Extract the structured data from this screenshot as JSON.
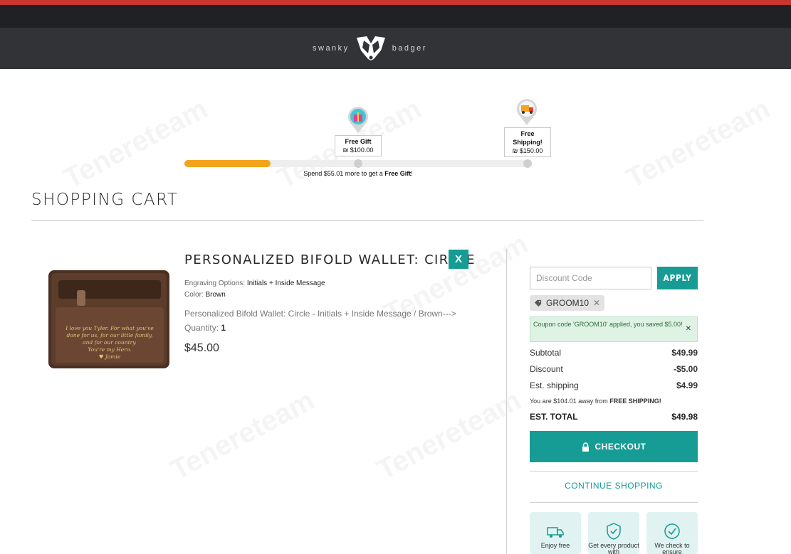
{
  "brand": {
    "left": "swanky",
    "right": "badger"
  },
  "progress": {
    "fill_fraction": 0.25,
    "milestones": [
      {
        "title": "Free Gift",
        "price": "₪ $100.00",
        "icon": "gift-icon"
      },
      {
        "title": "Free Shipping!",
        "price": "₪ $150.00",
        "icon": "truck-icon"
      }
    ],
    "spend_prefix": "Spend $55.01 more to get a ",
    "spend_bold": "Free Gift",
    "spend_suffix": "!"
  },
  "cart": {
    "title": "SHOPPING CART",
    "item": {
      "name": "PERSONALIZED BIFOLD WALLET: CIRCLE",
      "remove_label": "X",
      "engraving_label": "Engraving Options: ",
      "engraving_value": "Initials + Inside Message",
      "color_label": "Color: ",
      "color_value": "Brown",
      "variant": "Personalized Bifold Wallet: Circle - Initials + Inside Message / Brown--->",
      "quantity_label": "Quantity: ",
      "quantity_value": "1",
      "price": "$45.00",
      "engraving_text": [
        "I love you Tyler. For what you've",
        "done for us, for our little family,",
        "and for our country.",
        "You're my Hero.",
        "♥ Jamie"
      ]
    }
  },
  "summary": {
    "discount_placeholder": "Discount Code",
    "apply_label": "APPLY",
    "coupon_code": "GROOM10",
    "coupon_message": "Coupon code 'GROOM10' applied, you saved $5.00!",
    "subtotal_label": "Subtotal",
    "subtotal_value": "$49.99",
    "discount_label": "Discount",
    "discount_value": "-$5.00",
    "shipping_label": "Est. shipping",
    "shipping_value": "$4.99",
    "away_prefix": "You are $104.01 away from ",
    "away_bold": "FREE SHIPPING!",
    "total_label": "EST. TOTAL",
    "total_value": "$49.98",
    "checkout_label": "CHECKOUT",
    "continue_label": "CONTINUE SHOPPING",
    "features": [
      {
        "label": "Enjoy free",
        "icon": "free-shipping-icon"
      },
      {
        "label": "Get every product with",
        "icon": "shield-check-icon"
      },
      {
        "label": "We check to ensure",
        "icon": "badge-check-icon"
      }
    ]
  },
  "colors": {
    "accent": "#169c94",
    "progress": "#f2a51c",
    "topbar": "#c8372d"
  },
  "watermark": "Tenereteam"
}
